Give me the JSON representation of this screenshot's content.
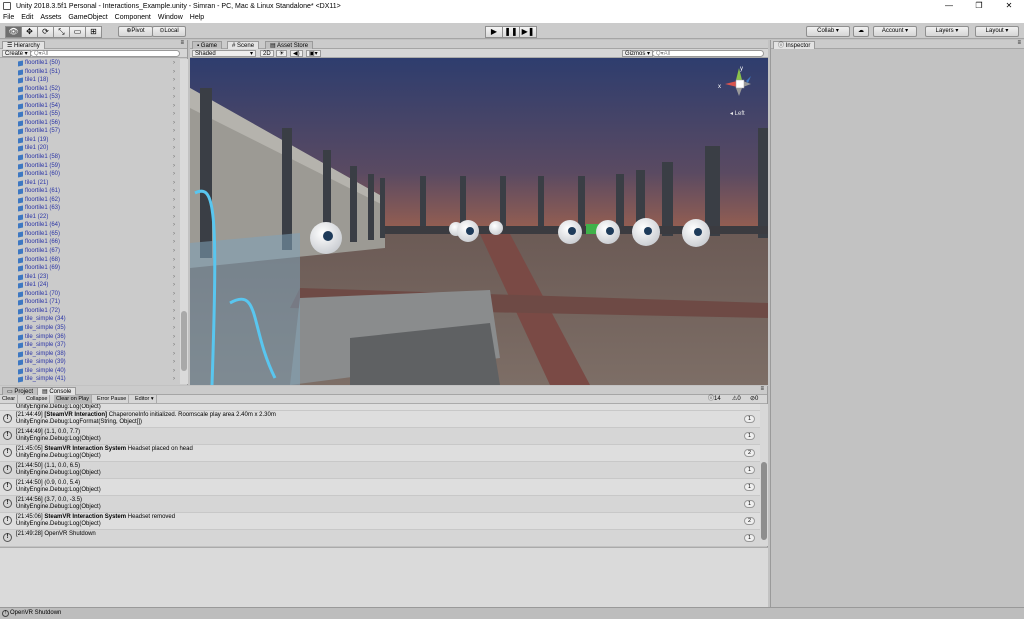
{
  "window": {
    "title": "Unity 2018.3.5f1 Personal - Interactions_Example.unity - Simran - PC, Mac & Linux Standalone* <DX11>",
    "minimize": "—",
    "maximize": "❐",
    "close": "✕"
  },
  "menu": [
    "File",
    "Edit",
    "Assets",
    "GameObject",
    "Component",
    "Window",
    "Help"
  ],
  "toolbar": {
    "tools": [
      "👁",
      "✥",
      "⟳",
      "⤡",
      "▭",
      "⊞"
    ],
    "pivot": "Pivot",
    "local": "Local",
    "play": "▶",
    "pause": "❚❚",
    "step": "▶❚",
    "collab": "Collab ▾",
    "cloud": "☁",
    "account": "Account",
    "layers": "Layers",
    "layout": "Layout"
  },
  "hierarchy": {
    "tab": "Hierarchy",
    "create": "Create ▾",
    "search_placeholder": "Q▾All",
    "items": [
      "floortile1 (50)",
      "floortile1 (51)",
      "tile1 (18)",
      "floortile1 (52)",
      "floortile1 (53)",
      "floortile1 (54)",
      "floortile1 (55)",
      "floortile1 (56)",
      "floortile1 (57)",
      "tile1 (19)",
      "tile1 (20)",
      "floortile1 (58)",
      "floortile1 (59)",
      "floortile1 (60)",
      "tile1 (21)",
      "floortile1 (61)",
      "floortile1 (62)",
      "floortile1 (63)",
      "tile1 (22)",
      "floortile1 (64)",
      "floortile1 (65)",
      "floortile1 (66)",
      "floortile1 (67)",
      "floortile1 (68)",
      "floortile1 (69)",
      "tile1 (23)",
      "tile1 (24)",
      "floortile1 (70)",
      "floortile1 (71)",
      "floortile1 (72)",
      "tile_simple (34)",
      "tile_simple (35)",
      "tile_simple (36)",
      "tile_simple (37)",
      "tile_simple (38)",
      "tile_simple (39)",
      "tile_simple (40)",
      "tile_simple (41)"
    ]
  },
  "scene": {
    "tabs": [
      "Game",
      "Scene",
      "Asset Store"
    ],
    "shading": "Shaded",
    "mode2d": "2D",
    "gizmos": "Gizmos ▾",
    "search_placeholder": "Q▾All",
    "gizmo_label": "◂ Left",
    "axis_y": "y",
    "axis_x": "x"
  },
  "inspector": {
    "tab": "Inspector"
  },
  "project_tab": "Project",
  "console": {
    "tab": "Console",
    "buttons": [
      "Clear",
      "Collapse",
      "Clear on Play",
      "Error Pause",
      "Editor ▾"
    ],
    "counts": {
      "log": "14",
      "warn": "0",
      "error": "0"
    },
    "top_line": "UnityEngine.Debug:Log(Object)",
    "entries": [
      {
        "time": "[21:44:49]",
        "bold": "[SteamVR Interaction]",
        "msg": " ChaperoneInfo initialized. Roomscale play area 2.40m x 2.30m",
        "trace": "UnityEngine.Debug:LogFormat(String, Object[])",
        "count": "1"
      },
      {
        "time": "[21:44:49]",
        "bold": "",
        "msg": " (1.1, 0.0, 7.7)",
        "trace": "UnityEngine.Debug:Log(Object)",
        "count": "1"
      },
      {
        "time": "[21:45:05]",
        "bold": "SteamVR Interaction System",
        "msg": " Headset placed on head",
        "trace": "UnityEngine.Debug:Log(Object)",
        "count": "2"
      },
      {
        "time": "[21:44:50]",
        "bold": "",
        "msg": " (1.1, 0.0, 6.5)",
        "trace": "UnityEngine.Debug:Log(Object)",
        "count": "1"
      },
      {
        "time": "[21:44:50]",
        "bold": "",
        "msg": " (0.9, 0.0, 5.4)",
        "trace": "UnityEngine.Debug:Log(Object)",
        "count": "1"
      },
      {
        "time": "[21:44:56]",
        "bold": "",
        "msg": " (3.7, 0.0, -3.5)",
        "trace": "UnityEngine.Debug:Log(Object)",
        "count": "1"
      },
      {
        "time": "[21:45:06]",
        "bold": "SteamVR Interaction System",
        "msg": " Headset removed",
        "trace": "UnityEngine.Debug:Log(Object)",
        "count": "2"
      },
      {
        "time": "[21:49:28]",
        "bold": "",
        "msg": " OpenVR Shutdown",
        "trace": "",
        "count": "1"
      }
    ]
  },
  "status": {
    "message": "OpenVR Shutdown"
  }
}
